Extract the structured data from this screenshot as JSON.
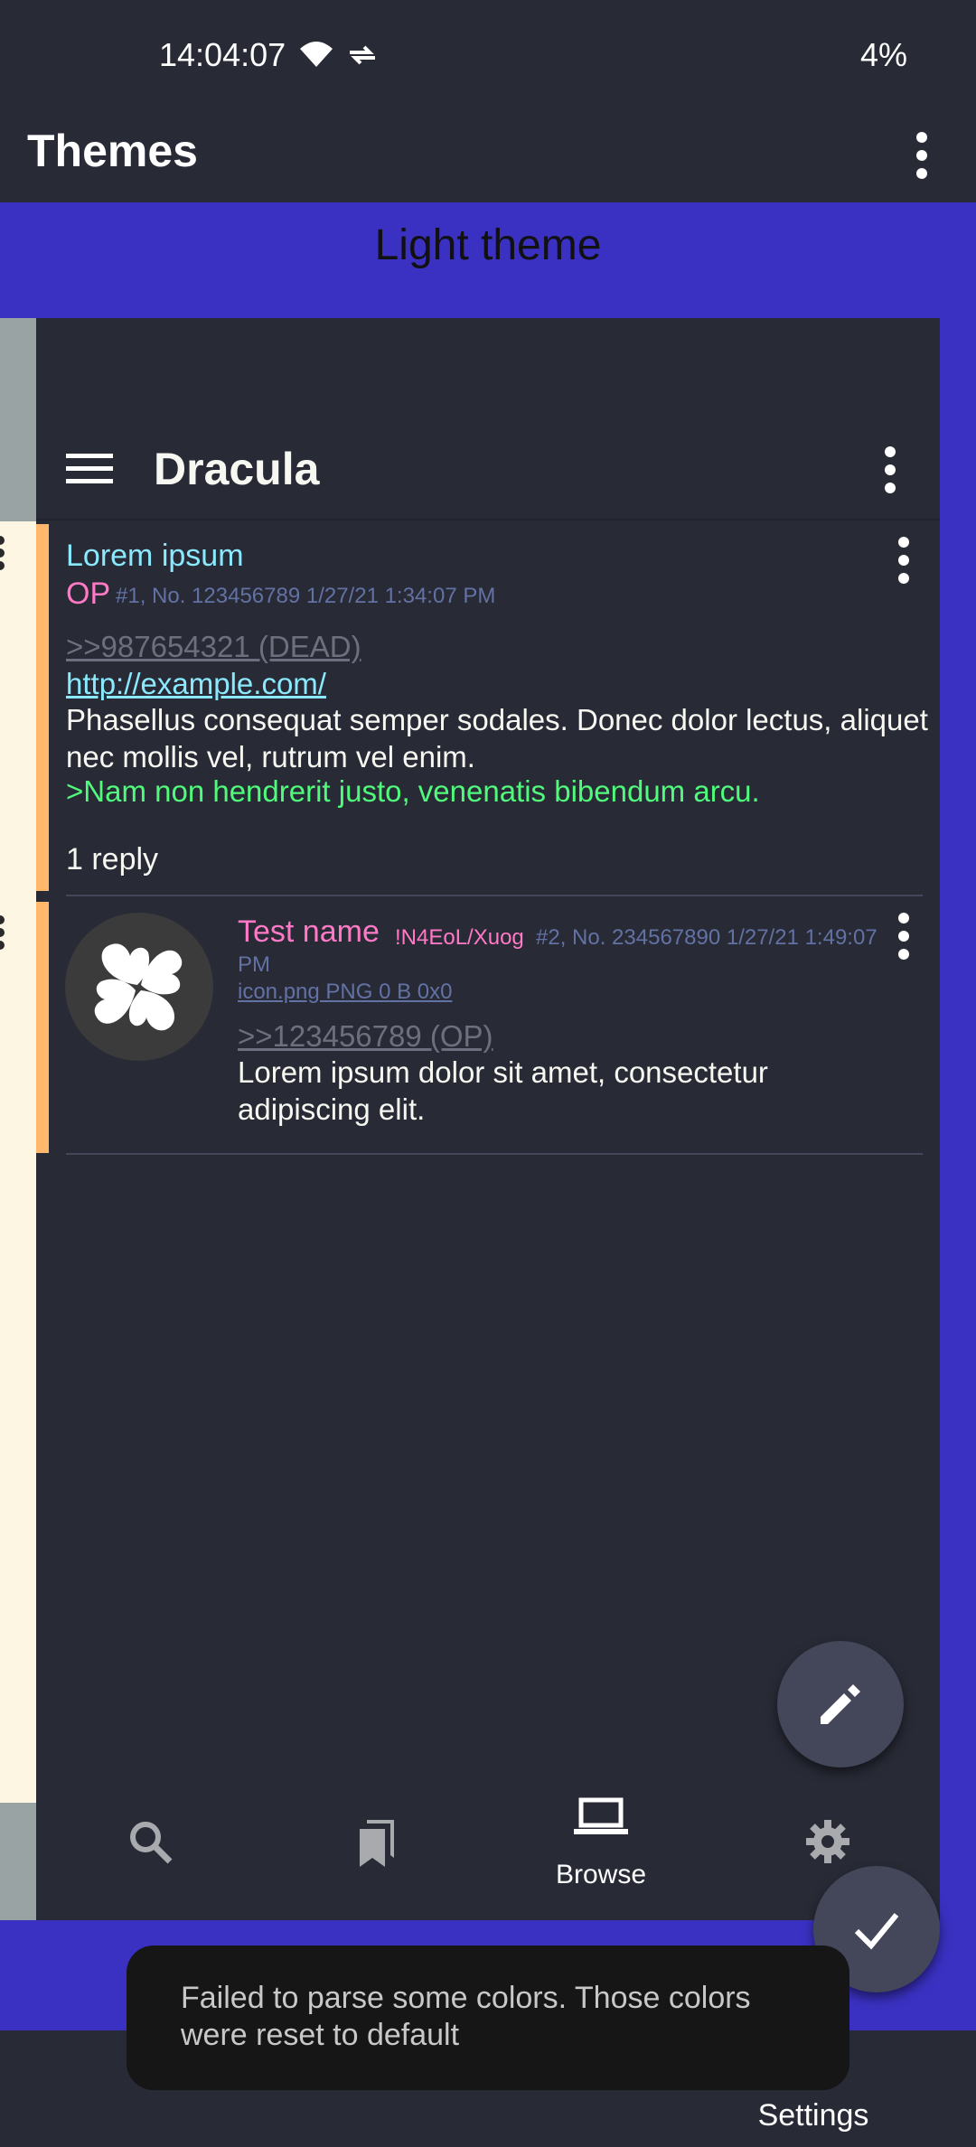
{
  "status_bar": {
    "time": "14:04:07",
    "battery": "4%"
  },
  "app_bar": {
    "title": "Themes",
    "more_icon": "more-vert-icon"
  },
  "theme_banner": {
    "name": "Light theme"
  },
  "preview": {
    "toolbar_title": "Dracula",
    "posts": [
      {
        "subject": "Lorem ipsum",
        "op_label": "OP",
        "meta": "#1, No. 123456789 1/27/21 1:34:07 PM",
        "dead_quote": ">>987654321 (DEAD)",
        "link": "http://example.com/",
        "body": "Phasellus consequat semper sodales. Donec dolor lectus, aliquet nec mollis vel, rutrum vel enim.",
        "greentext": ">Nam non hendrerit justo, venenatis bibendum arcu.",
        "replies": "1 reply"
      },
      {
        "name": "Test name",
        "tripcode": "!N4EoL/Xuog",
        "meta": "#2, No. 234567890 1/27/21 1:49:07",
        "meta_wrap": "PM",
        "file_info": "icon.png PNG 0 B 0x0",
        "quote": ">>123456789 (OP)",
        "body": "Lorem ipsum dolor sit amet, consectetur adipiscing elit."
      }
    ],
    "nav": [
      {
        "icon": "search-icon",
        "label": ""
      },
      {
        "icon": "bookmarks-icon",
        "label": ""
      },
      {
        "icon": "laptop-icon",
        "label": "Browse"
      },
      {
        "icon": "settings-gear-icon",
        "label": ""
      }
    ]
  },
  "app_nav": {
    "selected_label": "Settings"
  },
  "snackbar": {
    "message": "Failed to parse some colors. Those colors were reset to default"
  },
  "colors": {
    "background": "#282a36",
    "accent_blue": "#3a31c2",
    "post_bar": "#ffb86c",
    "subject": "#8be9fd",
    "name": "#ff79c6",
    "meta": "#6272a4",
    "greentext": "#50fa7b",
    "text": "#f8f8f2"
  }
}
